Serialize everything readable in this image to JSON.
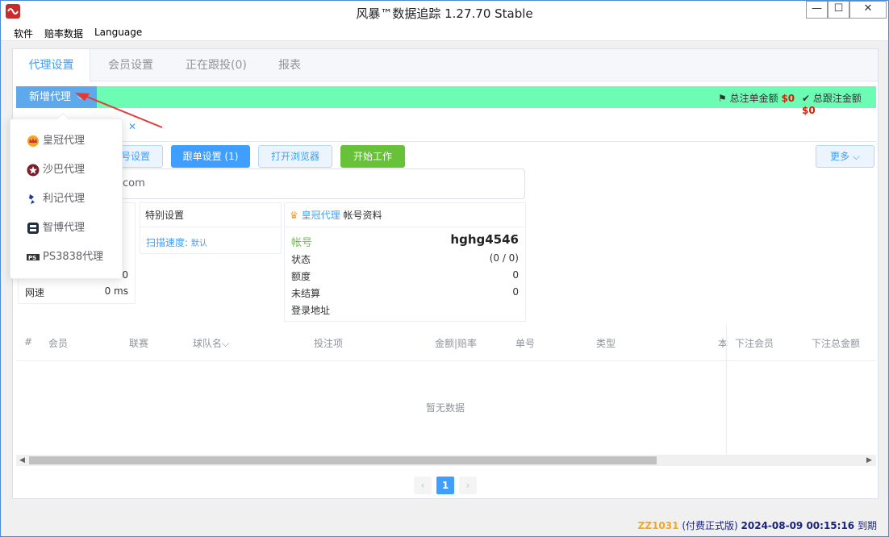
{
  "window": {
    "title": "风暴™数据追踪 1.27.70 Stable",
    "min_glyph": "—",
    "max_glyph": "☐",
    "close_glyph": "✕"
  },
  "menu": [
    "软件",
    "赔率数据",
    "Language"
  ],
  "tabs": [
    "代理设置",
    "会员设置",
    "正在跟投(0)",
    "报表"
  ],
  "toolbar": {
    "add_agent_label": "新增代理",
    "total_bet_label": "总注单金额",
    "total_bet_value": "$0",
    "total_follow_label": "总跟注金额",
    "total_follow_value": "$0"
  },
  "buttons": {
    "account_settings_partial": "号设置",
    "follow_settings": "跟单设置 (1)",
    "open_browser": "打开浏览器",
    "start_work": "开始工作",
    "more": "更多"
  },
  "url_partial": "com",
  "special_settings": {
    "title": "特别设置",
    "scan_speed_label": "扫描速度:",
    "scan_speed_value": "默认"
  },
  "left_card": {
    "value_partial": "0",
    "speed_label": "网速",
    "speed_value": "0 ms"
  },
  "account_card": {
    "agent_name": "皇冠代理",
    "title_suffix": "帐号资料",
    "account_label": "帐号",
    "account_value": "hghg4546",
    "status_label": "状态",
    "status_value": "(0 / 0)",
    "quota_label": "额度",
    "quota_value": "0",
    "unsettled_label": "未结算",
    "unsettled_value": "0",
    "login_label": "登录地址",
    "login_value": ""
  },
  "table": {
    "columns": [
      "#",
      "会员",
      "联赛",
      "球队名",
      "投注项",
      "金额|赔率",
      "单号",
      "类型",
      "本",
      "下注会员",
      "下注总金额"
    ],
    "empty_text": "暂无数据"
  },
  "pagination": {
    "prev": "‹",
    "current": "1",
    "next": "›"
  },
  "status": {
    "id": "ZZ1031",
    "edition": "(付费正式版)",
    "expiry": "2024-08-09 00:15:16",
    "expiry_suffix": "到期"
  },
  "dropdown": {
    "items": [
      {
        "label": "皇冠代理",
        "icon": "crown-icon"
      },
      {
        "label": "沙巴代理",
        "icon": "saba-star-icon"
      },
      {
        "label": "利记代理",
        "icon": "sbobet-icon"
      },
      {
        "label": "智博代理",
        "icon": "zhibo-icon"
      },
      {
        "label": "PS3838代理",
        "icon": "ps3838-icon"
      }
    ]
  },
  "colors": {
    "accent": "#409eff",
    "green_bar": "#6dfcb4",
    "money": "#d81e06",
    "success": "#67c23a"
  }
}
